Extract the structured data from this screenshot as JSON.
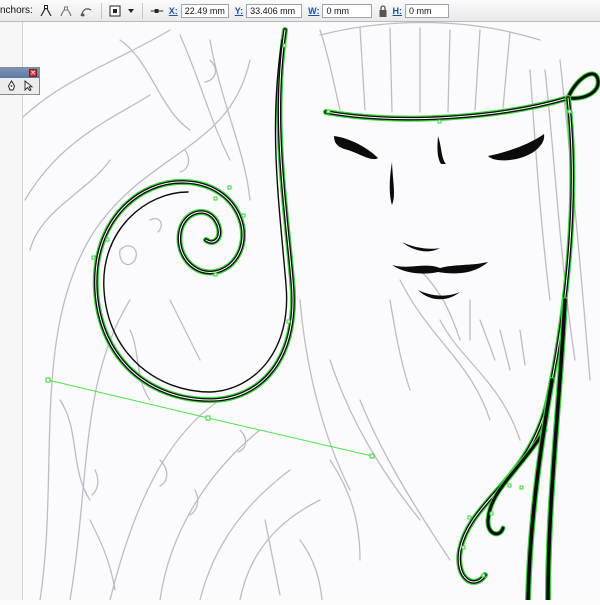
{
  "control_bar": {
    "anchors_label": "nchors:",
    "x_label": "X:",
    "x_value": "22.49 mm",
    "y_label": "Y:",
    "y_value": "33.406 mm",
    "w_label": "W:",
    "w_value": "0 mm",
    "h_label": "H:",
    "h_value": "0 mm"
  },
  "floating_panel": {
    "close_label": "✕",
    "tools": [
      "pen-tool-icon",
      "direct-selection-icon"
    ]
  },
  "icons": {
    "anchor_convert": "convert-anchor-icon",
    "anchor_remove": "remove-anchor-icon",
    "anchor_smooth": "smooth-anchor-icon",
    "anchor_options": "anchor-options-icon",
    "dropdown": "chevron-down-icon",
    "connect": "connect-anchor-icon",
    "lock": "lock-icon"
  },
  "colors": {
    "path_stroke": "#0c0c0c",
    "path_outline_highlight": "#3bd23b",
    "handle_line": "#4ee04e",
    "sketch_line": "#b9b9c2"
  }
}
